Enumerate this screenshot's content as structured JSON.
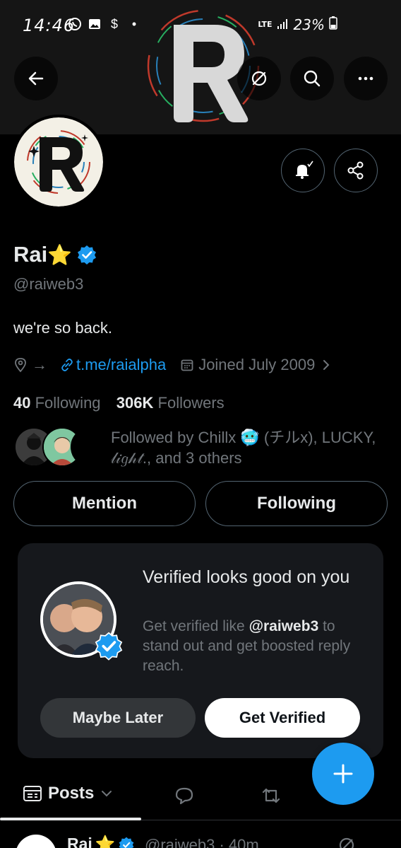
{
  "status": {
    "time": "14:46",
    "battery": "23%",
    "network": "LTE"
  },
  "nav": {
    "back_icon": "arrow-left-icon",
    "grok_icon": "grok-icon",
    "search_icon": "search-icon",
    "more_icon": "more-icon"
  },
  "profile": {
    "name": "Rai",
    "name_emoji": "⭐",
    "handle": "@raiweb3",
    "bio": "we're so back.",
    "location": "→",
    "link": "t.me/raialpha",
    "joined": "Joined July 2009",
    "following_count": "40",
    "following_label": "Following",
    "followers_count": "306K",
    "followers_label": "Followers",
    "followed_by": "Followed by Chillx 🥶 (チルx), LUCKY, 𝓁𝒾𝑔𝒽𝓉., and 3 others"
  },
  "actions": {
    "mention_label": "Mention",
    "following_label": "Following"
  },
  "verify_card": {
    "title": "Verified looks good on you",
    "sub_prefix": "Get verified like ",
    "sub_handle": "@raiweb3",
    "sub_suffix": " to stand out and get boosted reply reach.",
    "maybe_label": "Maybe Later",
    "get_label": "Get Verified"
  },
  "tabs": {
    "posts_label": "Posts"
  },
  "post_preview": {
    "name": "Rai",
    "emoji": "⭐",
    "handle_time": "@raiweb3 · 40m"
  },
  "colors": {
    "accent": "#1d9bf0",
    "background": "#000000",
    "muted": "#71767b"
  }
}
